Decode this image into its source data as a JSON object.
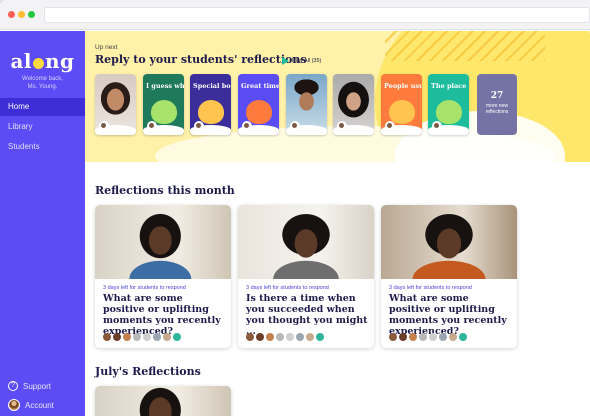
{
  "sidebar": {
    "logo_left": "al",
    "logo_right": "ng",
    "welcome_line1": "Welcome back,",
    "welcome_line2": "Ms. Young.",
    "nav": [
      {
        "label": "Home"
      },
      {
        "label": "Library"
      },
      {
        "label": "Students"
      }
    ],
    "support_label": "Support",
    "account_label": "Account"
  },
  "banner": {
    "upnext": "Up next",
    "title": "Reply to your students' reflections",
    "playall": "Play All (35)",
    "thumbs": [
      {
        "type": "photo",
        "title": ""
      },
      {
        "type": "prompt",
        "title": "I guess wh",
        "bg": "#1f7a5c",
        "blob": "#a7e36b"
      },
      {
        "type": "prompt",
        "title": "Special bo",
        "bg": "#3b2e9a",
        "blob": "#ffc44d"
      },
      {
        "type": "prompt",
        "title": "Great time",
        "bg": "#5a4df5",
        "blob": "#ff7a3d"
      },
      {
        "type": "photo2",
        "title": ""
      },
      {
        "type": "photo3",
        "title": ""
      },
      {
        "type": "prompt",
        "title": "People usu",
        "bg": "#ff7a3d",
        "blob": "#ffc44d"
      },
      {
        "type": "prompt",
        "title": "The place",
        "bg": "#1dbc9c",
        "blob": "#a7e36b"
      }
    ],
    "more_count": "27",
    "more_line1": "more new",
    "more_line2": "reflections"
  },
  "section1_title": "Reflections this month",
  "section2_title": "July's Reflections",
  "cards": [
    {
      "meta": "3 days left for students to respond",
      "question": "What are some positive or uplifting moments you recently experienced?"
    },
    {
      "meta": "3 days left for students to respond",
      "question": "Is there a time when you succeeded when you thought you might ..."
    },
    {
      "meta": "3 days left for students to respond",
      "question": "What are some positive or uplifting moments you recently experienced?"
    }
  ],
  "avatar_colors": [
    "#8a5a3c",
    "#6b3e2a",
    "#c4814d",
    "#b8b8b8",
    "#cfcfcf",
    "#9aa6b1",
    "#c7a98d",
    "#2fb59a"
  ],
  "colors": {
    "primary": "#5b4cf5",
    "nav_active": "#3d2ed8",
    "banner_bg": "#fff1a8",
    "accent_teal": "#1dbc9c",
    "heading": "#1d1b4b"
  }
}
